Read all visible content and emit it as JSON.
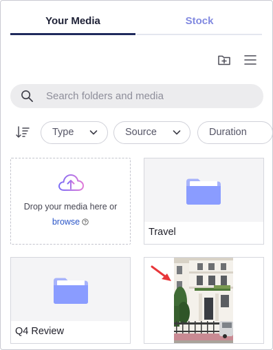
{
  "tabs": [
    {
      "label": "Your Media",
      "active": true
    },
    {
      "label": "Stock",
      "active": false
    }
  ],
  "toolbar": {
    "new_folder_icon": "folder-plus-icon",
    "menu_icon": "hamburger-menu-icon"
  },
  "search": {
    "placeholder": "Search folders and media",
    "value": ""
  },
  "filters": {
    "sort_icon": "sort-descending-icon",
    "chips": [
      "Type",
      "Source",
      "Duration"
    ]
  },
  "upload": {
    "line1": "Drop your media here or",
    "browse_label": "browse"
  },
  "folders": [
    {
      "name": "Travel"
    },
    {
      "name": "Q4 Review"
    }
  ],
  "colors": {
    "accent": "#8189e0",
    "active_tab_underline": "#1f2a5c",
    "folder": "#8a9cff",
    "upload_gradient_start": "#7b6cf6",
    "upload_gradient_end": "#e07ad8",
    "annotation_arrow": "#e8363a"
  }
}
